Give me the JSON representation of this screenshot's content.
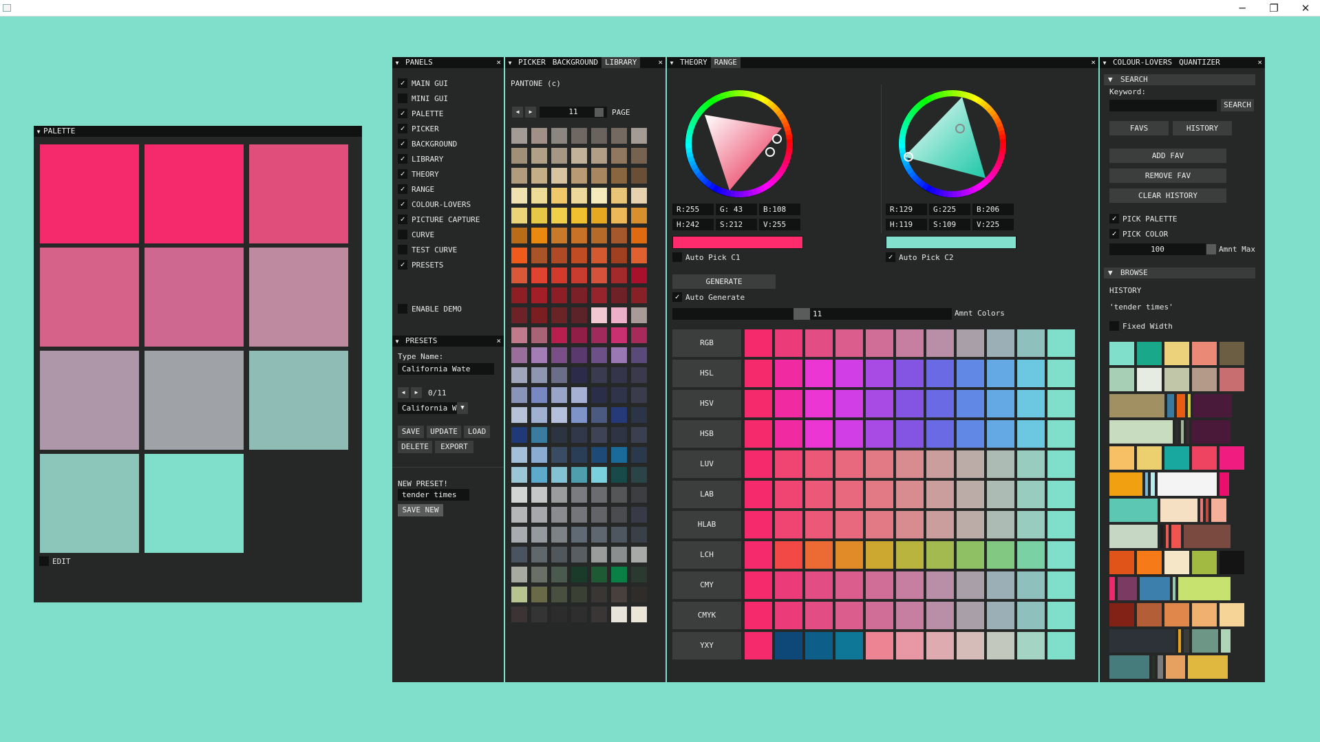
{
  "window": {
    "min": "─",
    "max": "❐",
    "close": "✕"
  },
  "palette": {
    "title": "PALETTE",
    "edit": "EDIT",
    "colors": [
      "#f42a6c",
      "#f42a6c",
      "#e04e7c",
      "#d6628a",
      "#cf6890",
      "#bd8aa0",
      "#ad97a8",
      "#9fa3a8",
      "#8fbcb4",
      "#8cc5b9",
      "#80dfcb"
    ]
  },
  "panels": {
    "title": "PANELS",
    "items": [
      {
        "label": "MAIN GUI",
        "on": true
      },
      {
        "label": "MINI GUI",
        "on": false
      },
      {
        "label": "PALETTE",
        "on": true
      },
      {
        "label": "PICKER",
        "on": true
      },
      {
        "label": "BACKGROUND",
        "on": true
      },
      {
        "label": "LIBRARY",
        "on": true
      },
      {
        "label": "THEORY",
        "on": true
      },
      {
        "label": "RANGE",
        "on": true
      },
      {
        "label": "COLOUR-LOVERS",
        "on": true
      },
      {
        "label": "PICTURE CAPTURE",
        "on": true
      },
      {
        "label": "CURVE",
        "on": false
      },
      {
        "label": "TEST CURVE",
        "on": false
      },
      {
        "label": "PRESETS",
        "on": true
      }
    ],
    "enable_demo": "ENABLE DEMO"
  },
  "presets": {
    "title": "PRESETS",
    "type_name": "Type Name:",
    "name_value": "California Wate",
    "counter": "0/11",
    "dropdown": "California W",
    "save": "SAVE",
    "update": "UPDATE",
    "load": "LOAD",
    "delete": "DELETE",
    "export": "EXPORT",
    "new_preset": "NEW PRESET!",
    "new_value": "tender times",
    "save_new": "SAVE NEW"
  },
  "library": {
    "tabs": [
      "PICKER",
      "BACKGROUND",
      "LIBRARY"
    ],
    "pantone": "PANTONE (c)",
    "page_num": "11",
    "page": "PAGE",
    "rows": [
      [
        "#a29b96",
        "#a09088",
        "#8c8680",
        "#6f6862",
        "#6a625c",
        "#746a62",
        "#a49c94"
      ],
      [
        "#a09078",
        "#b0a088",
        "#a69684",
        "#c2b29a",
        "#b29e86",
        "#907860",
        "#76624e"
      ],
      [
        "#b09c7c",
        "#c4ae88",
        "#d6c4a0",
        "#b89a74",
        "#a88660",
        "#8a6640",
        "#6a4e36"
      ],
      [
        "#efe2b0",
        "#ecdc98",
        "#f0c86a",
        "#ecd89a",
        "#f4eabc",
        "#e8c478",
        "#e6d2ae"
      ],
      [
        "#ebd478",
        "#e6c846",
        "#f0d04a",
        "#f0c030",
        "#e6a820",
        "#ecb858",
        "#d8902e"
      ],
      [
        "#b86c18",
        "#e88a10",
        "#c87a28",
        "#c87228",
        "#b66a2a",
        "#a4582c",
        "#e06a10"
      ],
      [
        "#f05a1a",
        "#a85428",
        "#b04a24",
        "#c04c24",
        "#d45830",
        "#a04020",
        "#e06030"
      ],
      [
        "#d85838",
        "#e04430",
        "#d43a2c",
        "#c83c30",
        "#d6523a",
        "#a22a2a",
        "#a8102c"
      ],
      [
        "#8c1e24",
        "#a41e28",
        "#8e1e26",
        "#7a2026",
        "#96242c",
        "#6e2228",
        "#882028"
      ],
      [
        "#6c2226",
        "#7a1e22",
        "#6a2426",
        "#5c2428",
        "#f2c8d2",
        "#ecb0c8",
        "#a89a98"
      ],
      [
        "#c07a8c",
        "#a86476",
        "#b81e4e",
        "#901e46",
        "#a02a5c",
        "#c83070",
        "#a82a5a"
      ],
      [
        "#9a6e9a",
        "#a27eb4",
        "#7a4e86",
        "#5a3a6e",
        "#6e5088",
        "#9a78b4",
        "#5a4a7a"
      ],
      [
        "#a0a6bc",
        "#8e96b0",
        "#6a6e88",
        "#2c2c4a",
        "#3a3a50",
        "#34344a",
        "#3a3a4c"
      ],
      [
        "#8894b8",
        "#7a88c2",
        "#98a4c8",
        "#a6b0d4",
        "#2a2e48",
        "#30344a",
        "#3a3c4c"
      ],
      [
        "#b6c2d8",
        "#a0b0d0",
        "#b4c0dc",
        "#7e94c8",
        "#4a5a80",
        "#263a7a",
        "#2c3448"
      ],
      [
        "#1e3a78",
        "#3a7ca0",
        "#2c3442",
        "#30384a",
        "#3e4456",
        "#2e3444",
        "#3a4050"
      ],
      [
        "#a4c0d8",
        "#8aacd0",
        "#3a4c64",
        "#2a3e58",
        "#1e4a78",
        "#1a6a9a",
        "#2a3a4c"
      ],
      [
        "#9ac6d6",
        "#5eaaca",
        "#82c2d4",
        "#4e9eae",
        "#7ad0dc",
        "#184a4a",
        "#2a4448"
      ],
      [
        "#d2d4d4",
        "#c4c6c8",
        "#9a9c9e",
        "#7a7c80",
        "#6a6c70",
        "#545658",
        "#3c3e42"
      ],
      [
        "#b4b6b8",
        "#a6a8ac",
        "#8a8c90",
        "#74767a",
        "#626468",
        "#4a4c50",
        "#383a48"
      ],
      [
        "#a8acb0",
        "#949a9e",
        "#7c8286",
        "#606a74",
        "#5e6670",
        "#4e5660",
        "#3a4048"
      ],
      [
        "#4a5460",
        "#60686e",
        "#50585e",
        "#585e62",
        "#9a9c9c",
        "#8a8e8e",
        "#a8aaa8"
      ],
      [
        "#a6aaa0",
        "#6a7066",
        "#4a5a4e",
        "#1a3a2a",
        "#1e5a34",
        "#0a8046",
        "#2a3a30"
      ],
      [
        "#b8c490",
        "#6a6a48",
        "#4a5040",
        "#3a4034",
        "#3a3634",
        "#48403c",
        "#302c2a"
      ],
      [
        "#3c3434",
        "#343434",
        "#2c2c2c",
        "#2e2e2e",
        "#3a3636",
        "#e8e4dc",
        "#ece6d8"
      ]
    ]
  },
  "theory": {
    "tabs": [
      "THEORY",
      "RANGE"
    ],
    "c1": {
      "r": "R:255",
      "g": "G: 43",
      "b": "B:108",
      "h": "H:242",
      "s": "S:212",
      "v": "V:255",
      "color": "#ff2b6c",
      "auto": "Auto Pick C1"
    },
    "c2": {
      "r": "R:129",
      "g": "G:225",
      "b": "B:206",
      "h": "H:119",
      "s": "S:109",
      "v": "V:225",
      "color": "#81e1ce",
      "auto": "Auto Pick C2"
    },
    "generate": "GENERATE",
    "auto_generate": "Auto Generate",
    "amount": "11",
    "amount_label": "Amnt Colors",
    "rows": [
      {
        "label": "RGB",
        "colors": [
          "#f42a6c",
          "#eb3b78",
          "#e24d84",
          "#da5d8e",
          "#d06e98",
          "#c67fa1",
          "#b98fa8",
          "#a89fa9",
          "#9bb0b6",
          "#8ec0be",
          "#80dfcb"
        ]
      },
      {
        "label": "HSL",
        "colors": [
          "#f42a6c",
          "#f02aa0",
          "#ec36d4",
          "#d23ee6",
          "#a84ae4",
          "#8454e2",
          "#6a6ae4",
          "#6088e4",
          "#64a8e4",
          "#6cc8e0",
          "#80dfcb"
        ]
      },
      {
        "label": "HSV",
        "colors": [
          "#f42a6c",
          "#f02aa0",
          "#ec36d4",
          "#d23ee6",
          "#a84ae4",
          "#8454e2",
          "#6a6ae4",
          "#6088e4",
          "#64a8e4",
          "#6cc8e0",
          "#80dfcb"
        ]
      },
      {
        "label": "HSB",
        "colors": [
          "#f42a6c",
          "#f02aa0",
          "#ec36d4",
          "#d23ee6",
          "#a84ae4",
          "#8454e2",
          "#6a6ae4",
          "#6088e4",
          "#64a8e4",
          "#6cc8e0",
          "#80dfcb"
        ]
      },
      {
        "label": "LUV",
        "colors": [
          "#f42a6c",
          "#f04472",
          "#ec5878",
          "#e8687e",
          "#e27a86",
          "#d88c90",
          "#ca9e9c",
          "#bcaca8",
          "#acbcb4",
          "#98ccbe",
          "#80dfcb"
        ]
      },
      {
        "label": "LAB",
        "colors": [
          "#f42a6c",
          "#f04472",
          "#ec5878",
          "#e8687e",
          "#e27a86",
          "#d88c90",
          "#ca9e9c",
          "#bcaca8",
          "#acbcb4",
          "#98ccbe",
          "#80dfcb"
        ]
      },
      {
        "label": "HLAB",
        "colors": [
          "#f42a6c",
          "#f04472",
          "#ec5878",
          "#e8687e",
          "#e27a86",
          "#d88c90",
          "#ca9e9c",
          "#bcaca8",
          "#acbcb4",
          "#98ccbe",
          "#80dfcb"
        ]
      },
      {
        "label": "LCH",
        "colors": [
          "#f42a6c",
          "#f24846",
          "#ec6a34",
          "#e08a28",
          "#cca830",
          "#b8b43e",
          "#a2ba50",
          "#90c064",
          "#82c882",
          "#7ad2a4",
          "#80dfcb"
        ]
      },
      {
        "label": "CMY",
        "colors": [
          "#f42a6c",
          "#eb3b78",
          "#e24d84",
          "#da5d8e",
          "#d06e98",
          "#c67fa1",
          "#b98fa8",
          "#a89fa9",
          "#9bb0b6",
          "#8ec0be",
          "#80dfcb"
        ]
      },
      {
        "label": "CMYK",
        "colors": [
          "#f42a6c",
          "#eb3b78",
          "#e24d84",
          "#da5d8e",
          "#d06e98",
          "#c67fa1",
          "#b98fa8",
          "#a89fa9",
          "#9bb0b6",
          "#8ec0be",
          "#80dfcb"
        ]
      },
      {
        "label": "YXY",
        "colors": [
          "#f42a6c",
          "#0e4878",
          "#0e5e8a",
          "#0e7696",
          "#ec8494",
          "#e898a4",
          "#deacb0",
          "#d6bcb8",
          "#c2c8be",
          "#a4d4c4",
          "#80dfcb"
        ]
      }
    ]
  },
  "lovers": {
    "tabs": [
      "COLOUR-LOVERS",
      "QUANTIZER"
    ],
    "search_hdr": "SEARCH",
    "keyword": "Keyword:",
    "search_btn": "SEARCH",
    "favs": "FAVS",
    "history": "HISTORY",
    "add_fav": "ADD FAV",
    "remove_fav": "REMOVE FAV",
    "clear_history": "CLEAR HISTORY",
    "pick_palette": "PICK PALETTE",
    "pick_color": "PICK COLOR",
    "amnt_value": "100",
    "amnt_label": "Amnt Max",
    "browse_hdr": "BROWSE",
    "browse_history": "HISTORY",
    "current": "'tender times'",
    "fixed_width": "Fixed Width",
    "rows": [
      [
        [
          "#80dfcb",
          36
        ],
        [
          "#1aa88a",
          36
        ],
        [
          "#ecd27a",
          36
        ],
        [
          "#ea8a76",
          36
        ],
        [
          "#6c5e42",
          36
        ]
      ],
      [
        [
          "#a6cfb6",
          36
        ],
        [
          "#e6ece2",
          36
        ],
        [
          "#c2c6a8",
          36
        ],
        [
          "#b49a88",
          36
        ],
        [
          "#c86e70",
          36
        ]
      ],
      [
        [
          "#a09062",
          80
        ],
        [
          "#3a7a9e",
          10
        ],
        [
          "#e85c14",
          12
        ],
        [
          "#d8c838",
          4
        ],
        [
          "#4a1a3a",
          56
        ]
      ],
      [
        [
          "#c8dcc0",
          92
        ],
        [
          "#2a2e2a",
          4
        ],
        [
          "#a2b698",
          4
        ],
        [
          "#3a2a30",
          4
        ],
        [
          "#4a1838",
          56
        ]
      ],
      [
        [
          "#f8c064",
          36
        ],
        [
          "#ecd070",
          36
        ],
        [
          "#18a8a0",
          36
        ],
        [
          "#ee4462",
          36
        ],
        [
          "#f01c80",
          36
        ]
      ],
      [
        [
          "#f0a010",
          48
        ],
        [
          "#7ab8d6",
          4
        ],
        [
          "#bce8f0",
          6
        ],
        [
          "#f4f4f4",
          86
        ],
        [
          "#e8106c",
          14
        ]
      ],
      [
        [
          "#5cc8b4",
          70
        ],
        [
          "#f6e0c4",
          54
        ],
        [
          "#e67a76",
          4
        ],
        [
          "#c0483c",
          4
        ],
        [
          "#f6b09a",
          22
        ]
      ],
      [
        [
          "#c6d8c4",
          70
        ],
        [
          "#1e1e1e",
          4
        ],
        [
          "#e85a52",
          4
        ],
        [
          "#f05450",
          14
        ],
        [
          "#7a4a40",
          68
        ]
      ],
      [
        [
          "#e0541a",
          36
        ],
        [
          "#f67a18",
          36
        ],
        [
          "#f6e6c8",
          36
        ],
        [
          "#a2ba42",
          36
        ],
        [
          "#141414",
          36
        ]
      ],
      [
        [
          "#ea2a6c",
          8
        ],
        [
          "#7a3a62",
          28
        ],
        [
          "#3c7eac",
          44
        ],
        [
          "#9ac6b4",
          4
        ],
        [
          "#c8e270",
          76
        ]
      ],
      [
        [
          "#822216",
          36
        ],
        [
          "#b45e38",
          36
        ],
        [
          "#e0884c",
          36
        ],
        [
          "#f0b070",
          36
        ],
        [
          "#f6d498",
          36
        ]
      ],
      [
        [
          "#2c3238",
          96
        ],
        [
          "#e6a01a",
          4
        ],
        [
          "#3a3c3c",
          8
        ],
        [
          "#6e9686",
          38
        ],
        [
          "#b0d4b8",
          14
        ]
      ],
      [
        [
          "#467c7c",
          58
        ],
        [
          "#283028",
          4
        ],
        [
          "#7a7c7c",
          8
        ],
        [
          "#e6a060",
          28
        ],
        [
          "#e0b840",
          58
        ]
      ]
    ]
  }
}
